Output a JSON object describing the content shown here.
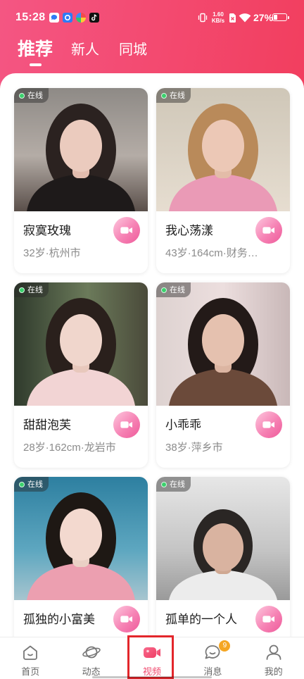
{
  "status_bar": {
    "time": "15:28",
    "notification_icons": [
      "message-app-icon",
      "blue-app-icon",
      "pinwheel-app-icon",
      "tiktok-icon"
    ],
    "system_icons": [
      "vibrate-icon",
      "no-sim-icon",
      "wifi-icon",
      "battery-icon"
    ],
    "net_speed": "1.60",
    "net_speed_unit": "KB/s",
    "battery_text": "27%",
    "battery_level": 0.27
  },
  "header": {
    "tabs": [
      {
        "label": "推荐",
        "active": true
      },
      {
        "label": "新人",
        "active": false
      },
      {
        "label": "同城",
        "active": false
      }
    ]
  },
  "feed": {
    "cards": [
      {
        "online_label": "在线",
        "name": "寂寞玫瑰",
        "info": "32岁·杭州市"
      },
      {
        "online_label": "在线",
        "name": "我心荡漾",
        "info": "43岁·164cm·财务…"
      },
      {
        "online_label": "在线",
        "name": "甜甜泡芙",
        "info": "28岁·162cm·龙岩市"
      },
      {
        "online_label": "在线",
        "name": "小乖乖",
        "info": "38岁·萍乡市"
      },
      {
        "online_label": "在线",
        "name": "孤独的小富美"
      },
      {
        "online_label": "在线",
        "name": "孤单的一个人"
      }
    ],
    "card_action_icon": "video-call-icon"
  },
  "bottom_nav": {
    "items": [
      {
        "label": "首页",
        "icon": "home-icon",
        "active": false
      },
      {
        "label": "动态",
        "icon": "planet-icon",
        "active": false
      },
      {
        "label": "视频",
        "icon": "video-icon",
        "active": true
      },
      {
        "label": "消息",
        "icon": "chat-icon",
        "active": false,
        "badge": "9"
      },
      {
        "label": "我的",
        "icon": "profile-icon",
        "active": false
      }
    ]
  },
  "colors": {
    "header_gradient_start": "#f45683",
    "header_gradient_end": "#f23e5e",
    "accent": "#f04c70",
    "online_dot": "#3ad16c",
    "message_badge": "#f5a623",
    "highlight_box": "#e3262b"
  }
}
